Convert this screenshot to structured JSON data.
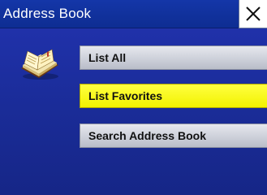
{
  "window": {
    "title": "Address Book"
  },
  "header": {
    "close_icon": "close-icon"
  },
  "sidebar": {
    "icon": "address-book-icon"
  },
  "menu": {
    "items": [
      {
        "label": "List All",
        "selected": false
      },
      {
        "label": "List Favorites",
        "selected": true
      },
      {
        "label": "Search Address Book",
        "selected": false
      }
    ]
  },
  "colors": {
    "background": "#1a2c98",
    "title_bar": "#0e2d92",
    "button": "#c8ccd6",
    "selected_button": "#ffff00"
  }
}
